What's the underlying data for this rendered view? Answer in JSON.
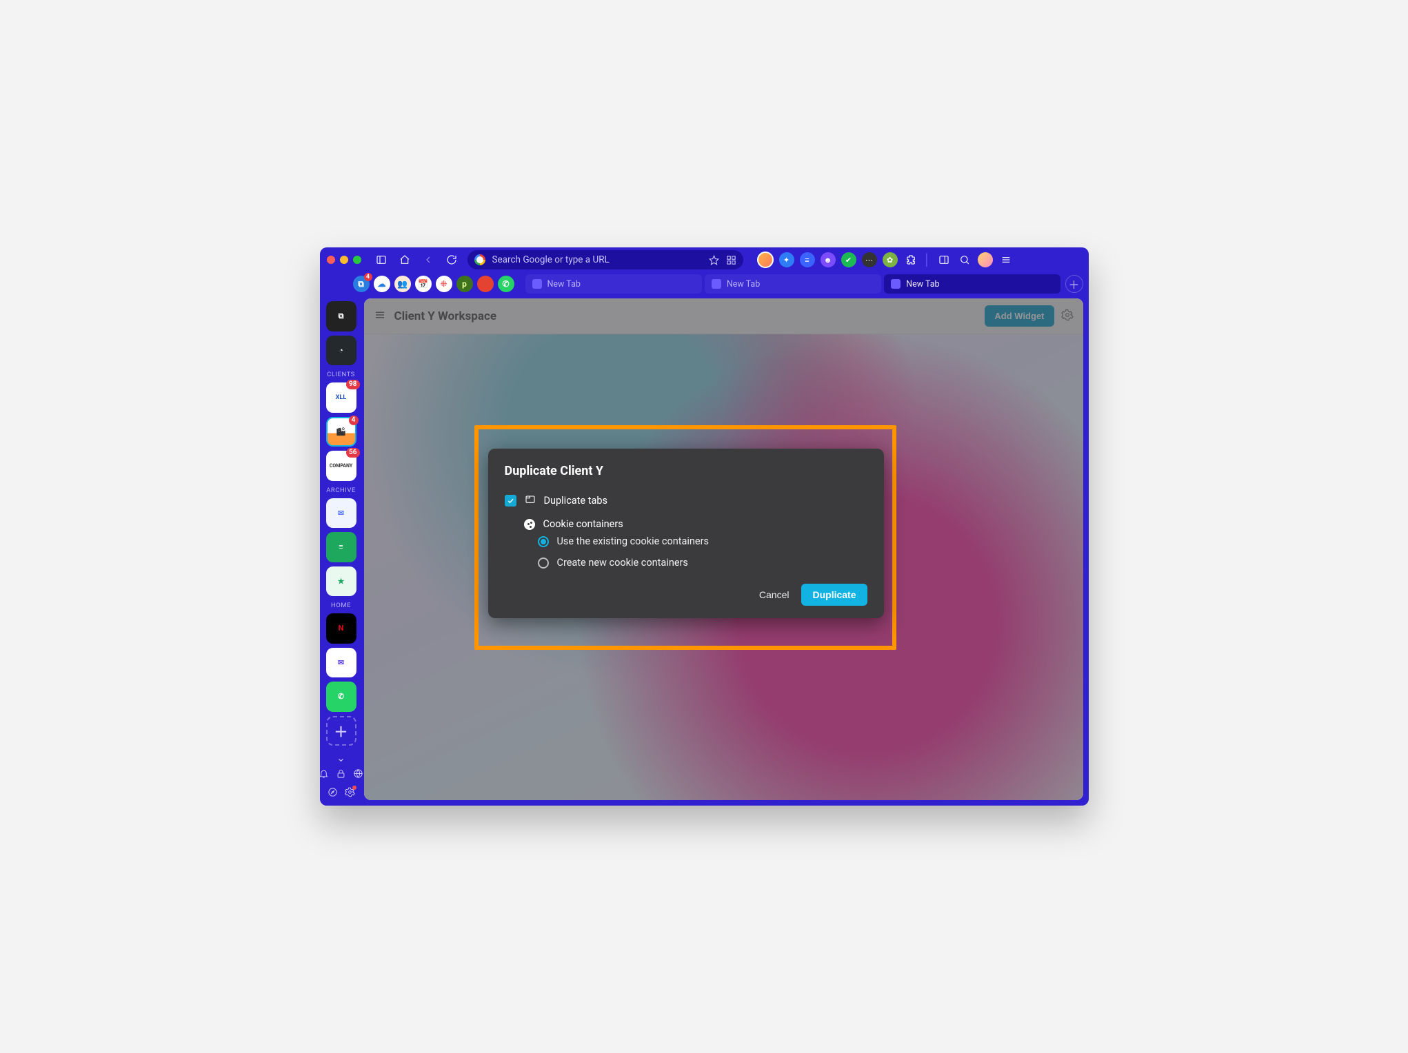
{
  "addressbar": {
    "placeholder": "Search Google or type a URL"
  },
  "tabs": [
    {
      "label": "New Tab"
    },
    {
      "label": "New Tab"
    },
    {
      "label": "New Tab"
    }
  ],
  "sidebar": {
    "sections": {
      "clients": "CLIENTS",
      "archive": "ARCHIVE",
      "home": "HOME"
    },
    "badges": {
      "client1": "98",
      "client2": "4",
      "client3": "56"
    },
    "tabapp_badge": "4"
  },
  "workspace": {
    "title": "Client Y Workspace",
    "addWidget": "Add Widget"
  },
  "modal": {
    "title": "Duplicate Client Y",
    "duplicateTabs": "Duplicate tabs",
    "cookieContainers": "Cookie containers",
    "radioUseExisting": "Use the existing cookie containers",
    "radioCreateNew": "Create new cookie containers",
    "cancel": "Cancel",
    "duplicate": "Duplicate"
  }
}
